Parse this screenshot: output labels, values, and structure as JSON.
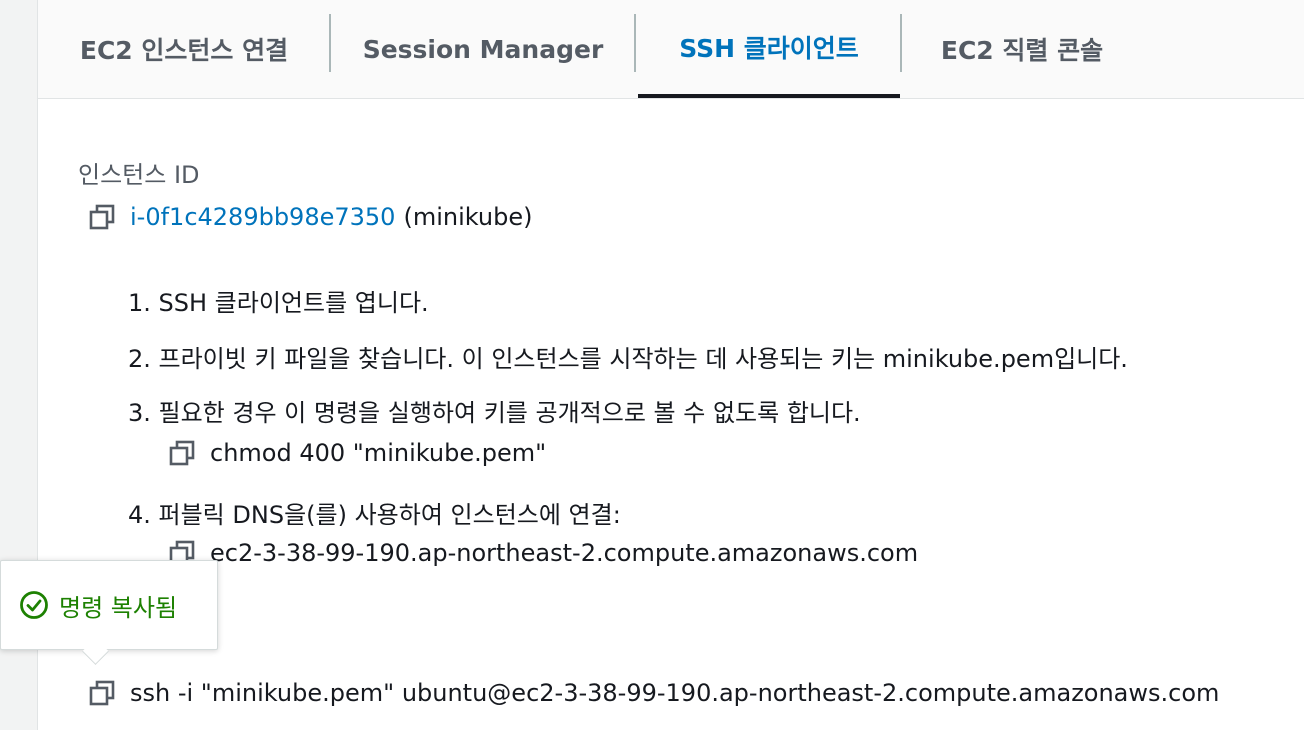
{
  "tabs": [
    {
      "label": "EC2 인스턴스 연결",
      "active": false
    },
    {
      "label": "Session Manager",
      "active": false
    },
    {
      "label": "SSH 클라이언트",
      "active": true
    },
    {
      "label": "EC2 직렬 콘솔",
      "active": false
    }
  ],
  "instance": {
    "label": "인스턴스 ID",
    "id": "i-0f1c4289bb98e7350",
    "name": "(minikube)"
  },
  "steps": [
    "1. SSH 클라이언트를 엽니다.",
    "2. 프라이빗 키 파일을 찾습니다. 이 인스턴스를 시작하는 데 사용되는 키는 minikube.pem입니다.",
    "3. 필요한 경우 이 명령을 실행하여 키를 공개적으로 볼 수 없도록 합니다.",
    "4. 퍼블릭 DNS을(를) 사용하여 인스턴스에 연결:"
  ],
  "chmod_command": "chmod 400 \"minikube.pem\"",
  "public_dns": "ec2-3-38-99-190.ap-northeast-2.compute.amazonaws.com",
  "ssh_command": "ssh -i \"minikube.pem\" ubuntu@ec2-3-38-99-190.ap-northeast-2.compute.amazonaws.com",
  "popover": {
    "text": "명령 복사됨",
    "icon": "check-circle-icon"
  },
  "colors": {
    "accent": "#0073bb",
    "success": "#1d8102",
    "text": "#16191f",
    "muted": "#545b64"
  }
}
